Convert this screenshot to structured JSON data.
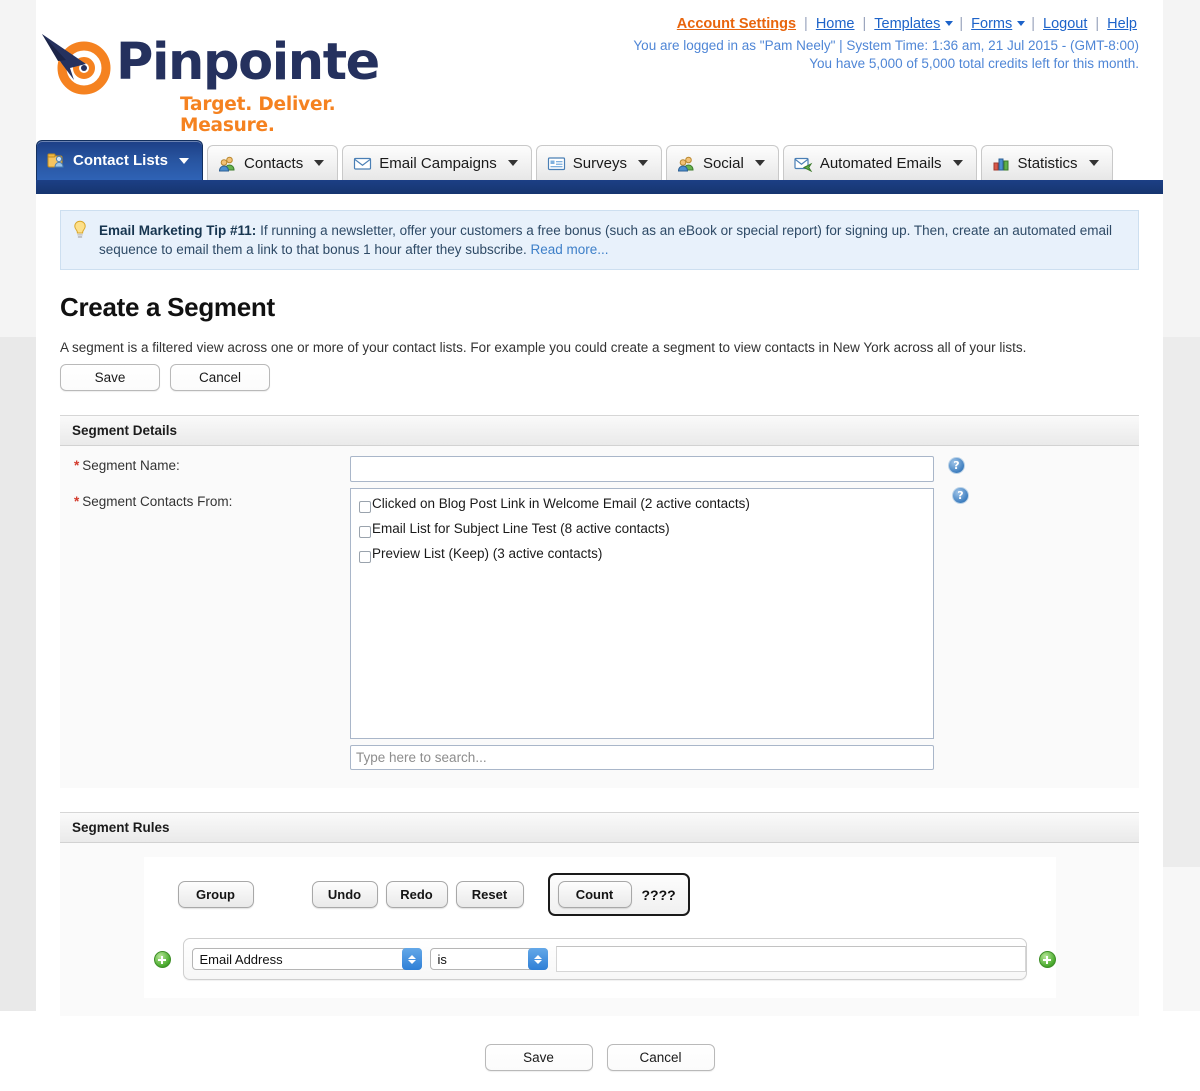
{
  "brand": {
    "name": "Pinpointe",
    "tagline": "Target. Deliver. Measure.",
    "word_color": "#25315e",
    "tagline_color": "#f58220"
  },
  "utility_nav": {
    "links": [
      {
        "label": "Account Settings",
        "accent": true,
        "caret": false
      },
      {
        "label": "Home",
        "accent": false,
        "caret": false
      },
      {
        "label": "Templates",
        "accent": false,
        "caret": true
      },
      {
        "label": "Forms",
        "accent": false,
        "caret": true
      },
      {
        "label": "Logout",
        "accent": false,
        "caret": false
      },
      {
        "label": "Help",
        "accent": false,
        "caret": false
      }
    ],
    "separator": "|",
    "status_line": "You are logged in as \"Pam Neely\" | System Time: 1:36 am, 21 Jul 2015 - (GMT-8:00)",
    "credits_line": "You have 5,000 of 5,000 total credits left for this month."
  },
  "tabs": [
    {
      "label": "Contact Lists",
      "icon": "contact-lists-icon",
      "active": true
    },
    {
      "label": "Contacts",
      "icon": "contacts-icon",
      "active": false
    },
    {
      "label": "Email Campaigns",
      "icon": "envelope-icon",
      "active": false
    },
    {
      "label": "Surveys",
      "icon": "survey-form-icon",
      "active": false
    },
    {
      "label": "Social",
      "icon": "social-people-icon",
      "active": false
    },
    {
      "label": "Automated Emails",
      "icon": "automated-email-icon",
      "active": false
    },
    {
      "label": "Statistics",
      "icon": "bar-chart-icon",
      "active": false
    }
  ],
  "tip": {
    "icon": "lightbulb-icon",
    "heading": "Email Marketing Tip #11:",
    "body": " If running a newsletter, offer your customers a free bonus (such as an eBook or special report) for signing up. Then, create an automated email sequence to email them a link to that bonus 1 hour after they subscribe. ",
    "read_more": "Read more..."
  },
  "page": {
    "title": "Create a Segment",
    "description": "A segment is a filtered view across one or more of your contact lists. For example you could create a segment to view contacts in New York across all of your lists.",
    "save_label": "Save",
    "cancel_label": "Cancel"
  },
  "segment_details": {
    "panel_title": "Segment Details",
    "required_marker": "*",
    "name_label": "Segment Name:",
    "name_value": "",
    "contacts_from_label": "Segment Contacts From:",
    "help_icon": "help-question-icon",
    "help_glyph": "?",
    "lists": [
      {
        "label": "Clicked on Blog Post Link in Welcome Email (2 active contacts)",
        "checked": false
      },
      {
        "label": "Email List for Subject Line Test (8 active contacts)",
        "checked": false
      },
      {
        "label": "Preview List (Keep) (3 active contacts)",
        "checked": false
      }
    ],
    "search_placeholder": "Type here to search...",
    "search_value": ""
  },
  "segment_rules": {
    "panel_title": "Segment Rules",
    "toolbar": {
      "group_label": "Group",
      "undo_label": "Undo",
      "redo_label": "Redo",
      "reset_label": "Reset",
      "count_label": "Count",
      "count_value": "????"
    },
    "rule": {
      "add_left_icon": "add-circle-icon",
      "add_right_icon": "add-circle-icon",
      "field_value": "Email Address",
      "operator_value": "is",
      "value": ""
    }
  },
  "footer": {
    "save_label": "Save",
    "cancel_label": "Cancel"
  }
}
